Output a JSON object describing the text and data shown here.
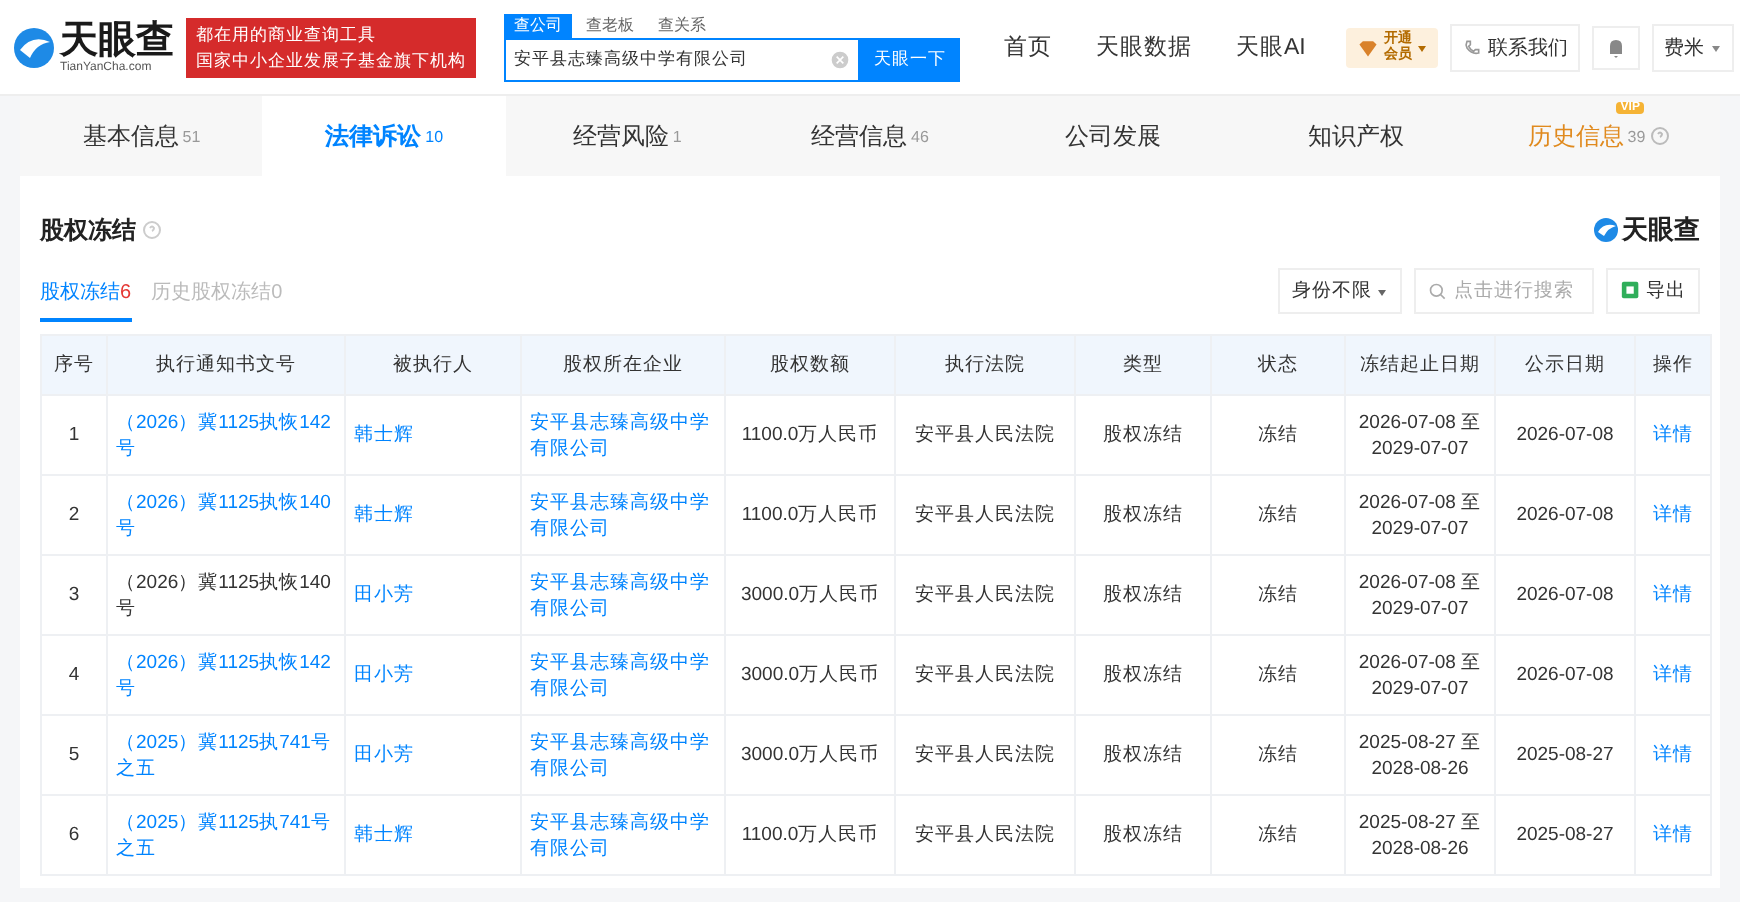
{
  "header": {
    "logo": {
      "name": "天眼查",
      "domain": "TianYanCha.com"
    },
    "banner": [
      "都在用的商业查询工具",
      "国家中小企业发展子基金旗下机构"
    ],
    "search_tabs": [
      {
        "label": "查公司",
        "selected": true
      },
      {
        "label": "查老板",
        "selected": false
      },
      {
        "label": "查关系",
        "selected": false
      }
    ],
    "search": {
      "value": "安平县志臻高级中学有限公司",
      "button": "天眼一下"
    },
    "nav": [
      "首页",
      "天眼数据",
      "天眼AI"
    ],
    "vip": {
      "line1": "开通",
      "line2": "会员"
    },
    "contact": "联系我们",
    "user": "费米"
  },
  "tabs": [
    {
      "label": "基本信息",
      "count": "51",
      "selected": false,
      "vip": false,
      "help": false
    },
    {
      "label": "法律诉讼",
      "count": "10",
      "selected": true,
      "vip": false,
      "help": false
    },
    {
      "label": "经营风险",
      "count": "1",
      "selected": false,
      "vip": false,
      "help": false
    },
    {
      "label": "经营信息",
      "count": "46",
      "selected": false,
      "vip": false,
      "help": false
    },
    {
      "label": "公司发展",
      "selected": false,
      "vip": false,
      "help": false
    },
    {
      "label": "知识产权",
      "selected": false,
      "vip": false,
      "help": false
    },
    {
      "label": "历史信息",
      "count": "39",
      "selected": false,
      "vip": true,
      "vip_label": "VIP",
      "help": true
    }
  ],
  "section": {
    "title": "股权冻结",
    "brand": "天眼查",
    "subtabs": [
      {
        "label": "股权冻结",
        "count": "6",
        "selected": true
      },
      {
        "label": "历史股权冻结",
        "count": "0",
        "selected": false
      }
    ],
    "filter": "身份不限",
    "search_placeholder": "点击进行搜索",
    "export": "导出"
  },
  "table": {
    "columns": [
      "序号",
      "执行通知书文号",
      "被执行人",
      "股权所在企业",
      "股权数额",
      "执行法院",
      "类型",
      "状态",
      "冻结起止日期",
      "公示日期",
      "操作"
    ],
    "rows": [
      {
        "cells": [
          "1",
          "（2026）冀1125执恢142号",
          "韩士辉",
          "安平县志臻高级中学有限公司",
          "1100.0万人民币",
          "安平县人民法院",
          "股权冻结",
          "冻结",
          "2026-07-08 至 2029-07-07",
          "2026-07-08",
          "详情"
        ],
        "doc_link": true
      },
      {
        "cells": [
          "2",
          "（2026）冀1125执恢140号",
          "韩士辉",
          "安平县志臻高级中学有限公司",
          "1100.0万人民币",
          "安平县人民法院",
          "股权冻结",
          "冻结",
          "2026-07-08 至 2029-07-07",
          "2026-07-08",
          "详情"
        ],
        "doc_link": true
      },
      {
        "cells": [
          "3",
          "（2026）冀1125执恢140号",
          "田小芳",
          "安平县志臻高级中学有限公司",
          "3000.0万人民币",
          "安平县人民法院",
          "股权冻结",
          "冻结",
          "2026-07-08 至 2029-07-07",
          "2026-07-08",
          "详情"
        ],
        "doc_link": false
      },
      {
        "cells": [
          "4",
          "（2026）冀1125执恢142号",
          "田小芳",
          "安平县志臻高级中学有限公司",
          "3000.0万人民币",
          "安平县人民法院",
          "股权冻结",
          "冻结",
          "2026-07-08 至 2029-07-07",
          "2026-07-08",
          "详情"
        ],
        "doc_link": true
      },
      {
        "cells": [
          "5",
          "（2025）冀1125执741号之五",
          "田小芳",
          "安平县志臻高级中学有限公司",
          "3000.0万人民币",
          "安平县人民法院",
          "股权冻结",
          "冻结",
          "2025-08-27 至 2028-08-26",
          "2025-08-27",
          "详情"
        ],
        "doc_link": true
      },
      {
        "cells": [
          "6",
          "（2025）冀1125执741号之五",
          "韩士辉",
          "安平县志臻高级中学有限公司",
          "1100.0万人民币",
          "安平县人民法院",
          "股权冻结",
          "冻结",
          "2025-08-27 至 2028-08-26",
          "2025-08-27",
          "详情"
        ],
        "doc_link": true
      }
    ]
  }
}
